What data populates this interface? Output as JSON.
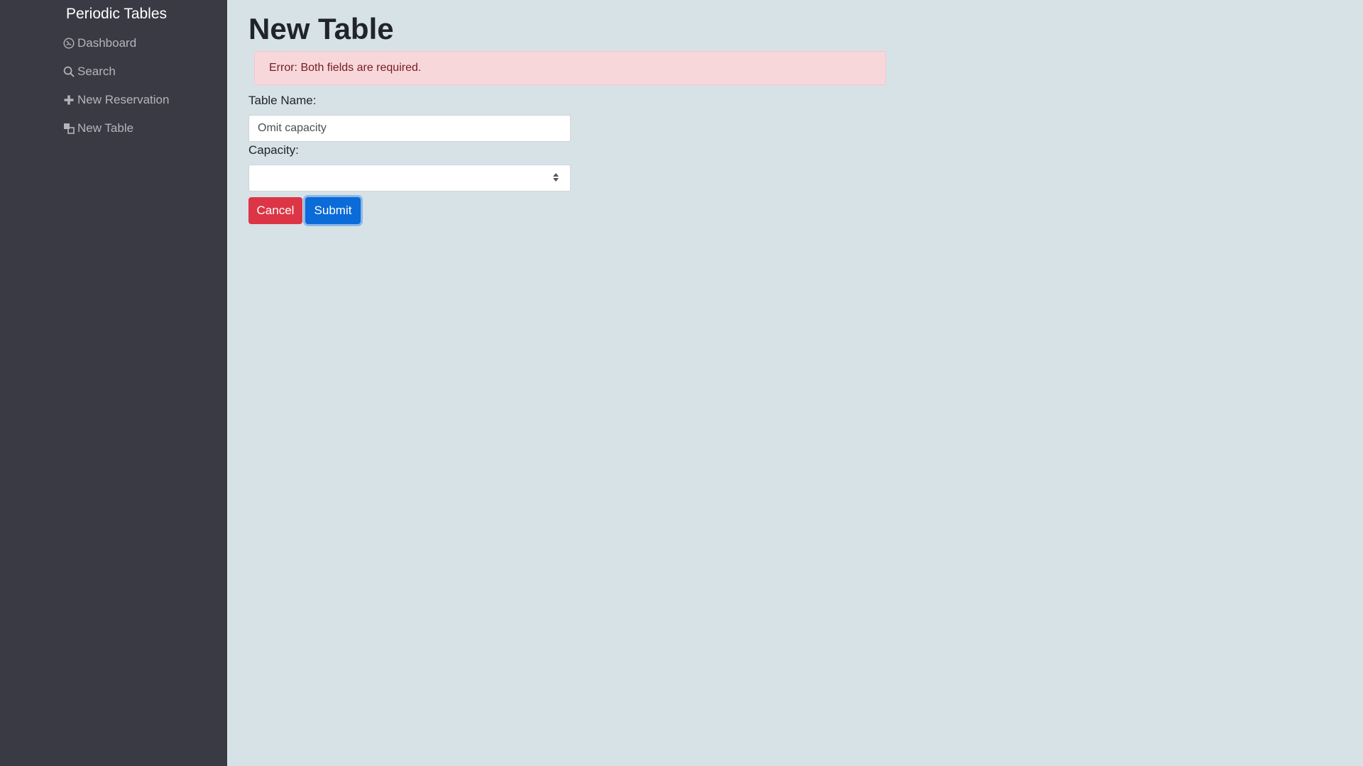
{
  "sidebar": {
    "brand": "Periodic Tables",
    "items": [
      {
        "label": "Dashboard",
        "icon": "dashboard-icon"
      },
      {
        "label": "Search",
        "icon": "search-icon"
      },
      {
        "label": "New Reservation",
        "icon": "plus-icon"
      },
      {
        "label": "New Table",
        "icon": "layers-icon"
      }
    ]
  },
  "main": {
    "title": "New Table",
    "error": "Error: Both fields are required.",
    "form": {
      "table_name_label": "Table Name:",
      "table_name_value": "Omit capacity",
      "capacity_label": "Capacity:",
      "capacity_value": "",
      "cancel_label": "Cancel",
      "submit_label": "Submit"
    }
  },
  "colors": {
    "sidebar_bg": "#393a44",
    "page_bg": "#d7e2e7",
    "cancel": "#dc3545",
    "submit": "#0b6bd8",
    "alert_bg": "#f8d7da",
    "alert_text": "#721c24"
  }
}
